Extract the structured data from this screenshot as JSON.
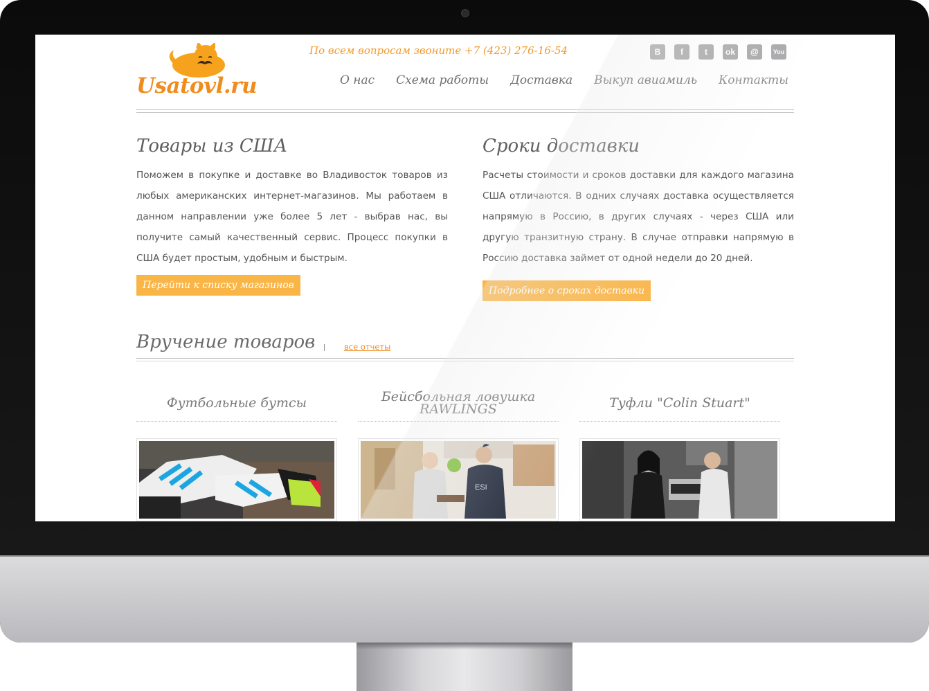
{
  "header": {
    "logo_text": "Usatovl.ru",
    "phone": "По всем вопросам звоните +7 (423) 276-16-54",
    "social": [
      {
        "icon": "vk-icon",
        "glyph": "B"
      },
      {
        "icon": "facebook-icon",
        "glyph": "f"
      },
      {
        "icon": "twitter-icon",
        "glyph": "t"
      },
      {
        "icon": "odnoklassniki-icon",
        "glyph": "ok"
      },
      {
        "icon": "mail-icon",
        "glyph": "@"
      },
      {
        "icon": "youtube-icon",
        "glyph": "You"
      }
    ],
    "nav": [
      "О нас",
      "Схема работы",
      "Доставка",
      "Выкуп авиамиль",
      "Контакты"
    ]
  },
  "left_column": {
    "title": "Товары из США",
    "text": "Поможем в покупке и доставке во Владивосток товаров из любых американских интернет-магазинов. Мы работаем в данном направлении уже более 5 лет - выбрав нас, вы получите самый качественный сервис. Процесс покупки в США будет простым, удобным и быстрым.",
    "button": "Перейти к списку магазинов"
  },
  "right_column": {
    "title": "Сроки доставки",
    "text": "Расчеты стоимости и сроков доставки для каждого магазина США отличаются. В одних случаях доставка осуществляется напрямую в Россию, в других случаях - через США или другую транзитную страну. В случае отправки напрямую в Россию доставка займет от одной недели до 20 дней.",
    "button": "Подробнее о сроках доставки"
  },
  "reports": {
    "title": "Вручение товаров",
    "link": "все отчеты",
    "items": [
      {
        "title": "Футбольные бутсы"
      },
      {
        "title": "Бейсбольная ловушка RAWLINGS"
      },
      {
        "title": "Туфли \"Colin Stuart\""
      }
    ]
  },
  "colors": {
    "accent": "#f08c1e",
    "button": "#fab547",
    "text": "#555555",
    "heading": "#5f5f5f"
  }
}
